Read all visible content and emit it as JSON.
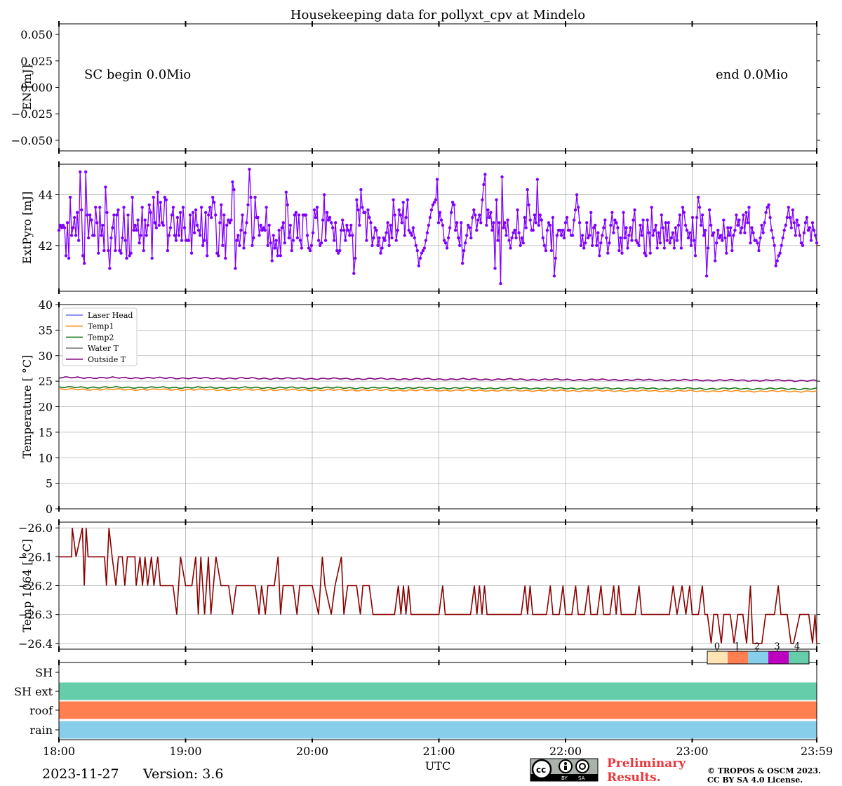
{
  "chart_data": [
    {
      "type": "line",
      "title": "Housekeeping data for pollyxt_cpv at Mindelo",
      "ylabel": "EN [mJ]",
      "ylim": [
        -0.06,
        0.06
      ],
      "yticks": [
        "0.050",
        "0.025",
        "0.000",
        "−0.025",
        "−0.050"
      ],
      "annotations": [
        "SC begin 0.0Mio",
        "end 0.0Mio"
      ],
      "series": []
    },
    {
      "type": "line",
      "ylabel": "ExtPyro [mJ]",
      "ylim": [
        40.2,
        45.2
      ],
      "yticks": [
        "44",
        "42"
      ],
      "color": "#7f00ff",
      "x_start_hour": 18.0,
      "x_step_hour": 0.0286,
      "values": [
        42.6,
        42.8,
        42.7,
        42.8,
        42.7,
        41.6,
        42.9,
        41.5,
        43.9,
        42.4,
        42.7,
        43.1,
        42.4,
        43.3,
        42.2,
        44.9,
        43.4,
        41.6,
        41.3,
        44.9,
        43.2,
        42.3,
        43.2,
        43.0,
        42.4,
        42.4,
        43.5,
        42.9,
        41.7,
        43.5,
        42.4,
        42.8,
        41.8,
        44.3,
        43.3,
        41.8,
        41.1,
        42.3,
        42.7,
        43.2,
        41.8,
        43.2,
        43.4,
        41.8,
        41.7,
        42.3,
        43.5,
        42.2,
        41.5,
        43.2,
        41.6,
        41.7,
        43.9,
        42.6,
        42.8,
        42.6,
        43.0,
        42.1,
        42.4,
        43.5,
        41.8,
        43.0,
        42.4,
        42.8,
        43.6,
        43.3,
        41.5,
        43.9,
        42.9,
        42.7,
        44.1,
        42.8,
        43.7,
        42.9,
        42.8,
        43.9,
        43.8,
        41.8,
        42.4,
        42.7,
        43.2,
        43.5,
        42.4,
        42.2,
        43.1,
        42.4,
        43.3,
        42.2,
        43.5,
        42.7,
        42.2,
        42.2,
        42.2,
        43.2,
        41.7,
        43.3,
        42.5,
        43.4,
        42.8,
        42.6,
        42.4,
        43.5,
        42.0,
        42.2,
        43.3,
        41.6,
        43.2,
        43.5,
        43.1,
        43.9,
        43.7,
        43.2,
        41.7,
        41.6,
        42.9,
        43.6,
        42.0,
        43.2,
        41.5,
        42.8,
        43.0,
        42.9,
        43.0,
        44.5,
        44.2,
        41.1,
        42.2,
        42.4,
        42.0,
        42.6,
        43.2,
        41.9,
        42.5,
        42.9,
        43.6,
        45.0,
        43.9,
        42.0,
        42.3,
        43.9,
        43.1,
        43.1,
        42.4,
        42.8,
        42.6,
        42.7,
        42.6,
        43.5,
        42.0,
        42.8,
        42.1,
        41.4,
        42.4,
        41.9,
        42.2,
        41.6,
        42.6,
        41.6,
        42.7,
        42.9,
        42.1,
        44.1,
        43.6,
        42.3,
        42.8,
        41.8,
        42.2,
        43.2,
        43.3,
        42.3,
        43.2,
        42.2,
        41.9,
        43.2,
        43.2,
        43.2,
        42.4,
        41.9,
        41.8,
        42.0,
        42.5,
        43.4,
        43.1,
        43.5,
        42.2,
        42.0,
        42.1,
        43.0,
        44.0,
        42.2,
        43.3,
        43.0,
        43.1,
        42.9,
        42.7,
        42.2,
        42.9,
        41.8,
        41.7,
        41.8,
        42.6,
        43.0,
        42.6,
        42.2,
        42.8,
        42.6,
        42.4,
        42.8,
        42.4,
        40.9,
        41.5,
        43.8,
        43.4,
        42.8,
        44.2,
        43.5,
        43.3,
        43.3,
        42.2,
        43.4,
        43.1,
        42.9,
        42.0,
        42.3,
        42.7,
        42.6,
        42.0,
        42.3,
        41.7,
        41.9,
        42.3,
        42.2,
        42.5,
        42.9,
        42.0,
        42.8,
        42.3,
        43.8,
        43.2,
        42.2,
        42.6,
        43.4,
        43.2,
        42.9,
        43.7,
        42.4,
        43.1,
        43.8,
        42.6,
        42.5,
        42.4,
        42.7,
        42.3,
        42.0,
        41.8,
        41.2,
        41.5,
        41.7,
        41.8,
        41.9,
        42.2,
        42.5,
        42.8,
        43.1,
        43.4,
        43.6,
        43.7,
        43.8,
        44.6,
        42.9,
        43.3,
        43.0,
        42.8,
        42.2,
        42.1,
        41.9,
        42.3,
        42.7,
        43.3,
        43.7,
        43.6,
        42.6,
        42.9,
        42.3,
        42.0,
        42.9,
        41.3,
        41.8,
        42.1,
        42.4,
        42.8,
        42.7,
        42.3,
        43.1,
        43.4,
        43.2,
        42.6,
        43.0,
        43.2,
        42.9,
        43.8,
        44.4,
        44.8,
        42.8,
        43.4,
        43.1,
        43.3,
        42.6,
        42.9,
        41.1,
        43.8,
        42.2,
        42.9,
        40.5,
        44.7,
        42.7,
        42.9,
        42.4,
        43.0,
        42.2,
        41.9,
        42.3,
        42.5,
        42.6,
        42.3,
        43.4,
        42.5,
        42.0,
        42.3,
        42.1,
        43.1,
        42.7,
        44.2,
        43.6,
        43.0,
        42.6,
        42.6,
        43.2,
        42.9,
        44.6,
        42.8,
        43.2,
        43.0,
        42.3,
        42.0,
        41.8,
        42.6,
        42.9,
        42.8,
        41.8,
        43.1,
        40.8,
        41.5,
        42.4,
        42.6,
        42.6,
        42.4,
        42.6,
        42.3,
        42.9,
        43.1,
        42.6,
        42.6,
        42.4,
        42.4,
        43.0,
        43.4,
        44.0,
        43.5,
        42.9,
        42.0,
        42.4,
        41.9,
        42.1,
        42.9,
        42.3,
        42.4,
        43.3,
        42.0,
        42.7,
        42.8,
        42.0,
        42.5,
        41.6,
        42.1,
        42.4,
        42.7,
        43.0,
        42.3,
        41.7,
        42.1,
        42.8,
        43.3,
        42.5,
        43.0,
        42.9,
        42.7,
        41.8,
        42.3,
        41.7,
        43.3,
        42.3,
        42.7,
        41.9,
        42.4,
        42.7,
        42.2,
        43.0,
        43.4,
        42.2,
        42.1,
        42.0,
        42.8,
        42.4,
        43.0,
        41.7,
        41.6,
        43.0,
        42.5,
        41.7,
        43.5,
        42.4,
        42.6,
        42.8,
        41.9,
        42.5,
        42.1,
        43.2,
        42.7,
        41.9,
        42.9,
        42.2,
        42.9,
        42.1,
        42.3,
        42.5,
        41.9,
        42.7,
        42.2,
        42.8,
        43.2,
        41.9,
        43.5,
        43.3,
        42.8,
        42.6,
        42.3,
        42.5,
        42.0,
        43.1,
        42.2,
        41.6,
        43.1,
        43.9,
        43.5,
        42.8,
        43.2,
        42.4,
        42.6,
        40.8,
        41.9,
        43.4,
        42.8,
        42.4,
        42.5,
        41.4,
        42.1,
        42.6,
        42.3,
        42.4,
        42.2,
        43.0,
        42.3,
        41.7,
        42.7,
        42.4,
        42.7,
        41.8,
        42.4,
        42.6,
        43.2,
        42.8,
        43.0,
        42.5,
        42.7,
        43.2,
        42.5,
        43.3,
        42.9,
        43.5,
        42.1,
        42.7,
        42.5,
        42.2,
        42.2,
        42.1,
        41.8,
        42.3,
        42.8,
        42.5,
        42.9,
        43.3,
        43.5,
        43.6,
        43.1,
        42.6,
        42.3,
        42.0,
        41.2,
        41.4,
        41.6,
        41.7,
        42.0,
        42.3,
        42.6,
        42.8,
        43.1,
        43.5,
        43.1,
        42.7,
        43.4,
        42.9,
        42.4,
        43.0,
        42.8,
        42.4,
        42.1,
        42.0,
        42.5,
        42.9,
        43.1,
        42.6,
        42.7,
        42.2,
        42.9,
        42.6,
        42.4,
        42.1
      ]
    },
    {
      "type": "line",
      "ylabel": "Temperature [$^\\circ C$]",
      "ylim": [
        0,
        40
      ],
      "yticks": [
        "40",
        "35",
        "30",
        "25",
        "20",
        "15",
        "10",
        "5",
        "0"
      ],
      "legend_position": "upper-left",
      "series": [
        {
          "name": "Laser Head",
          "color": "#6b6bf5",
          "values": []
        },
        {
          "name": "Temp1",
          "color": "#ff8c1a",
          "start": 23.4,
          "end": 23.0
        },
        {
          "name": "Temp2",
          "color": "#1a7a1a",
          "start": 23.8,
          "end": 23.5
        },
        {
          "name": "Water T",
          "color": "#808080",
          "values": []
        },
        {
          "name": "Outside T",
          "color": "#800080",
          "start": 25.7,
          "end": 25.1
        }
      ]
    },
    {
      "type": "line",
      "ylabel": "Temp 1064 [$^\\circ C$]",
      "ylim": [
        -26.42,
        -25.98
      ],
      "yticks": [
        "−26.0",
        "−26.1",
        "−26.2",
        "−26.3",
        "−26.4"
      ],
      "color": "#8b0000",
      "segments": [
        [
          18.0,
          -26.1
        ],
        [
          18.1,
          -26.1
        ],
        [
          18.105,
          -26.0
        ],
        [
          18.135,
          -26.1
        ],
        [
          18.185,
          -26.0
        ],
        [
          18.2,
          -26.2
        ],
        [
          18.215,
          -26.0
        ],
        [
          18.23,
          -26.1
        ],
        [
          18.36,
          -26.1
        ],
        [
          18.375,
          -26.2
        ],
        [
          18.395,
          -26.0
        ],
        [
          18.42,
          -26.1
        ],
        [
          18.45,
          -26.2
        ],
        [
          18.47,
          -26.1
        ],
        [
          18.5,
          -26.1
        ],
        [
          18.52,
          -26.2
        ],
        [
          18.54,
          -26.1
        ],
        [
          18.6,
          -26.1
        ],
        [
          18.61,
          -26.2
        ],
        [
          18.64,
          -26.1
        ],
        [
          18.66,
          -26.2
        ],
        [
          18.68,
          -26.1
        ],
        [
          18.7,
          -26.2
        ],
        [
          18.73,
          -26.1
        ],
        [
          18.75,
          -26.2
        ],
        [
          18.78,
          -26.1
        ],
        [
          18.8,
          -26.2
        ],
        [
          18.9,
          -26.2
        ],
        [
          18.93,
          -26.3
        ],
        [
          18.96,
          -26.1
        ],
        [
          19.0,
          -26.2
        ],
        [
          19.05,
          -26.2
        ],
        [
          19.08,
          -26.1
        ],
        [
          19.1,
          -26.3
        ],
        [
          19.12,
          -26.1
        ],
        [
          19.15,
          -26.3
        ],
        [
          19.18,
          -26.1
        ],
        [
          19.2,
          -26.3
        ],
        [
          19.24,
          -26.1
        ],
        [
          19.28,
          -26.2
        ],
        [
          19.34,
          -26.2
        ],
        [
          19.37,
          -26.3
        ],
        [
          19.4,
          -26.2
        ],
        [
          19.55,
          -26.2
        ],
        [
          19.58,
          -26.3
        ],
        [
          19.6,
          -26.2
        ],
        [
          19.63,
          -26.3
        ],
        [
          19.65,
          -26.2
        ],
        [
          19.7,
          -26.2
        ],
        [
          19.73,
          -26.1
        ],
        [
          19.75,
          -26.3
        ],
        [
          19.77,
          -26.2
        ],
        [
          19.85,
          -26.2
        ],
        [
          19.88,
          -26.3
        ],
        [
          19.9,
          -26.2
        ],
        [
          20.0,
          -26.2
        ],
        [
          20.05,
          -26.3
        ],
        [
          20.08,
          -26.1
        ],
        [
          20.1,
          -26.2
        ],
        [
          20.15,
          -26.3
        ],
        [
          20.18,
          -26.2
        ],
        [
          20.23,
          -26.1
        ],
        [
          20.25,
          -26.3
        ],
        [
          20.28,
          -26.2
        ],
        [
          20.35,
          -26.2
        ],
        [
          20.38,
          -26.3
        ],
        [
          20.4,
          -26.2
        ],
        [
          20.45,
          -26.2
        ],
        [
          20.48,
          -26.3
        ],
        [
          20.5,
          -26.3
        ],
        [
          20.65,
          -26.3
        ],
        [
          20.68,
          -26.2
        ],
        [
          20.7,
          -26.3
        ],
        [
          20.72,
          -26.2
        ],
        [
          20.74,
          -26.3
        ],
        [
          20.76,
          -26.2
        ],
        [
          20.78,
          -26.3
        ],
        [
          21.0,
          -26.3
        ],
        [
          21.03,
          -26.2
        ],
        [
          21.05,
          -26.3
        ],
        [
          21.25,
          -26.3
        ],
        [
          21.28,
          -26.2
        ],
        [
          21.3,
          -26.3
        ],
        [
          21.32,
          -26.2
        ],
        [
          21.34,
          -26.3
        ],
        [
          21.36,
          -26.2
        ],
        [
          21.38,
          -26.3
        ],
        [
          21.65,
          -26.3
        ],
        [
          21.68,
          -26.2
        ],
        [
          21.7,
          -26.3
        ],
        [
          21.72,
          -26.2
        ],
        [
          21.74,
          -26.3
        ],
        [
          21.85,
          -26.3
        ],
        [
          21.88,
          -26.2
        ],
        [
          21.9,
          -26.3
        ],
        [
          21.95,
          -26.3
        ],
        [
          21.98,
          -26.2
        ],
        [
          22.0,
          -26.3
        ],
        [
          22.05,
          -26.3
        ],
        [
          22.08,
          -26.2
        ],
        [
          22.1,
          -26.3
        ],
        [
          22.15,
          -26.3
        ],
        [
          22.18,
          -26.2
        ],
        [
          22.2,
          -26.3
        ],
        [
          22.25,
          -26.3
        ],
        [
          22.28,
          -26.2
        ],
        [
          22.3,
          -26.3
        ],
        [
          22.35,
          -26.3
        ],
        [
          22.38,
          -26.2
        ],
        [
          22.4,
          -26.3
        ],
        [
          22.42,
          -26.2
        ],
        [
          22.44,
          -26.3
        ],
        [
          22.55,
          -26.3
        ],
        [
          22.58,
          -26.2
        ],
        [
          22.6,
          -26.3
        ],
        [
          22.82,
          -26.3
        ],
        [
          22.85,
          -26.2
        ],
        [
          22.88,
          -26.3
        ],
        [
          22.92,
          -26.2
        ],
        [
          22.95,
          -26.3
        ],
        [
          22.98,
          -26.2
        ],
        [
          23.0,
          -26.3
        ],
        [
          23.05,
          -26.3
        ],
        [
          23.08,
          -26.2
        ],
        [
          23.1,
          -26.3
        ],
        [
          23.12,
          -26.3
        ],
        [
          23.15,
          -26.4
        ],
        [
          23.17,
          -26.3
        ],
        [
          23.2,
          -26.3
        ],
        [
          23.23,
          -26.4
        ],
        [
          23.25,
          -26.3
        ],
        [
          23.3,
          -26.3
        ],
        [
          23.33,
          -26.4
        ],
        [
          23.36,
          -26.3
        ],
        [
          23.4,
          -26.3
        ],
        [
          23.43,
          -26.4
        ],
        [
          23.46,
          -26.2
        ],
        [
          23.48,
          -26.4
        ],
        [
          23.55,
          -26.4
        ],
        [
          23.58,
          -26.3
        ],
        [
          23.6,
          -26.3
        ],
        [
          23.65,
          -26.3
        ],
        [
          23.68,
          -26.2
        ],
        [
          23.7,
          -26.3
        ],
        [
          23.75,
          -26.3
        ],
        [
          23.78,
          -26.4
        ],
        [
          23.8,
          -26.4
        ],
        [
          23.85,
          -26.3
        ],
        [
          23.92,
          -26.3
        ],
        [
          23.95,
          -26.4
        ],
        [
          23.97,
          -26.3
        ],
        [
          23.99,
          -26.4
        ]
      ]
    },
    {
      "type": "heatmap",
      "rows": [
        "SH",
        "SH ext",
        "roof",
        "rain"
      ],
      "row_values": [
        null,
        4,
        1,
        2
      ],
      "colorbar": {
        "ticks": [
          "0",
          "1",
          "2",
          "3",
          "4"
        ],
        "colors": [
          "#ffe4b5",
          "#ff7f50",
          "#87ceeb",
          "#c000c0",
          "#66cdaa"
        ]
      }
    }
  ],
  "x_axis": {
    "xlabel": "UTC",
    "xticks": [
      "18:00",
      "19:00",
      "20:00",
      "21:00",
      "22:00",
      "23:00",
      "23:59"
    ],
    "xlim": [
      "18:00",
      "23:59"
    ]
  },
  "footer": {
    "date": "2023-11-27",
    "version": "Version: 3.6",
    "license_badge": "cc-by-sa-icon",
    "preliminary_line1": "Preliminary",
    "preliminary_line2": "Results.",
    "copyright_line1": "© TROPOS & OSCM 2023.",
    "copyright_line2": "CC BY SA 4.0 License."
  }
}
